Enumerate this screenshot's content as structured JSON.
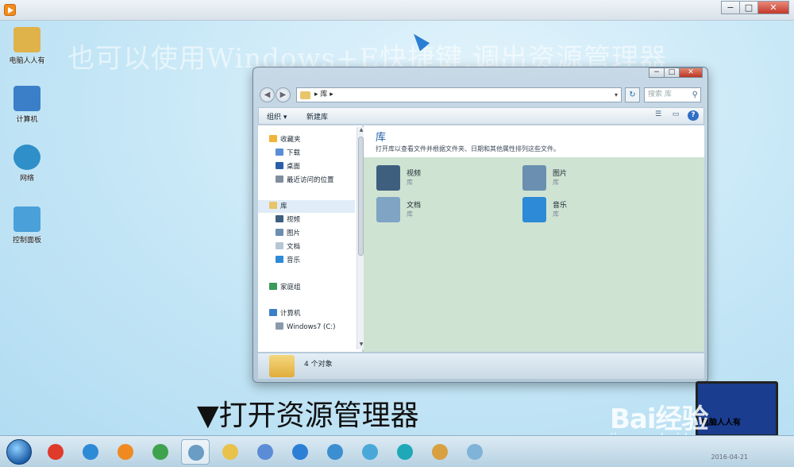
{
  "outer_window": {
    "controls": [
      "−",
      "□",
      "✕"
    ]
  },
  "desktop": {
    "watermark_text": "也可以使用Windows+E快捷键,调出资源管理器",
    "icons": [
      {
        "label": "电脑人人有",
        "color": "#e0b24a"
      },
      {
        "label": "计算机",
        "color": "#3a7fc8"
      },
      {
        "label": "网络",
        "color": "#2f8fc8"
      },
      {
        "label": "控制面板",
        "color": "#4aa0d8"
      }
    ]
  },
  "explorer": {
    "controls": [
      "−",
      "□",
      "✕"
    ],
    "address": {
      "breadcrumb": "▸ 库 ▸"
    },
    "search_placeholder": "搜索 库",
    "commands": {
      "organize": "组织 ▾",
      "new_library": "新建库"
    },
    "nav": {
      "favorites": "收藏夹",
      "downloads": "下载",
      "desktop": "桌面",
      "recent": "最近访问的位置",
      "libraries": "库",
      "videos": "视频",
      "pictures": "图片",
      "documents": "文档",
      "music": "音乐",
      "homegroup": "家庭组",
      "computer": "计算机",
      "drive_c": "Windows7 (C:)"
    },
    "content": {
      "title": "库",
      "description": "打开库以查看文件并根据文件夹、日期和其他属性排列这些文件。",
      "items": [
        {
          "name": "视频",
          "sub": "库",
          "color": "#3f5f7f"
        },
        {
          "name": "图片",
          "sub": "库",
          "color": "#6a8fb0"
        },
        {
          "name": "文档",
          "sub": "库",
          "color": "#7fa4c4"
        },
        {
          "name": "音乐",
          "sub": "库",
          "color": "#2d8ad6"
        }
      ]
    },
    "details": {
      "count": "4 个对象"
    }
  },
  "caption": "▼打开资源管理器",
  "taskbar": {
    "clock_date": "2016-04-21",
    "apps": [
      {
        "name": "jiang",
        "color": "#e03a2a"
      },
      {
        "name": "ie",
        "color": "#2d8ad6"
      },
      {
        "name": "media",
        "color": "#f08a20"
      },
      {
        "name": "chrome",
        "color": "#3fa34d"
      },
      {
        "name": "explorer",
        "color": "#6a9cc4"
      },
      {
        "name": "folder",
        "color": "#e8c24a"
      },
      {
        "name": "doc",
        "color": "#5b8dd6"
      },
      {
        "name": "qq-browser",
        "color": "#2d7fd6"
      },
      {
        "name": "remote",
        "color": "#3b8fd0"
      },
      {
        "name": "pinwheel",
        "color": "#4aa8d8"
      },
      {
        "name": "headset",
        "color": "#1fa8b8"
      },
      {
        "name": "paint",
        "color": "#d8a040"
      },
      {
        "name": "window",
        "color": "#7fb3d8"
      }
    ]
  },
  "branding": {
    "logo_text": "Bai经验",
    "url": "jingyan.baidu.com",
    "screen_text": "电脑人人有"
  }
}
